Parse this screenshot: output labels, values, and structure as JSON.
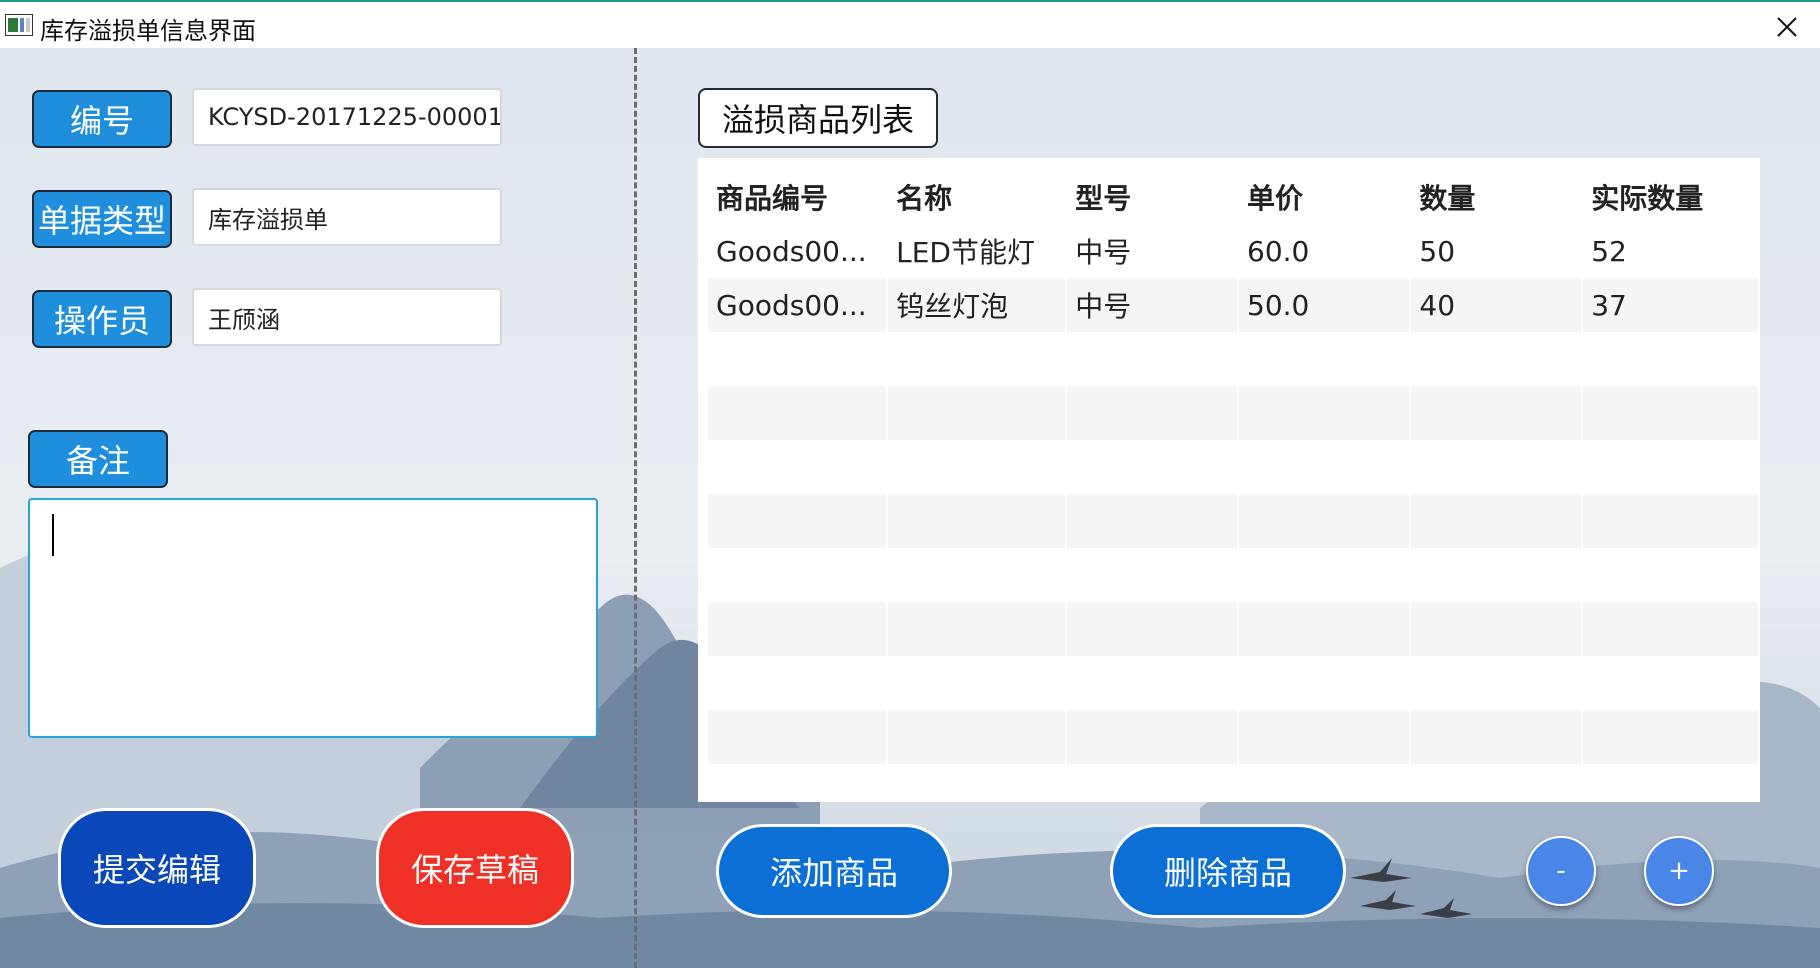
{
  "window": {
    "title": "库存溢损单信息界面"
  },
  "form": {
    "id_label": "编号",
    "id_value": "KCYSD-20171225-00001",
    "type_label": "单据类型",
    "type_value": "库存溢损单",
    "operator_label": "操作员",
    "operator_value": "王颀涵",
    "remark_label": "备注",
    "remark_value": ""
  },
  "actions": {
    "submit": "提交编辑",
    "save_draft": "保存草稿",
    "add_goods": "添加商品",
    "delete_goods": "删除商品",
    "zoom_out": "-",
    "zoom_in": "+"
  },
  "goods_list": {
    "title": "溢损商品列表",
    "columns": [
      "商品编号",
      "名称",
      "型号",
      "单价",
      "数量",
      "实际数量"
    ],
    "rows": [
      [
        "Goods00...",
        "LED节能灯",
        "中号",
        "60.0",
        "50",
        "52"
      ],
      [
        "Goods00...",
        "钨丝灯泡",
        "中号",
        "50.0",
        "40",
        "37"
      ]
    ]
  },
  "colors": {
    "label_blue": "#1f8fdd",
    "submit_blue": "#0a47b8",
    "draft_red": "#ee3027",
    "action_blue": "#0c6fd6",
    "round_blue": "#4a86e8",
    "title_accent": "#1e9b8a"
  },
  "icons": {
    "app": "app-window-icon",
    "close": "close-icon"
  }
}
